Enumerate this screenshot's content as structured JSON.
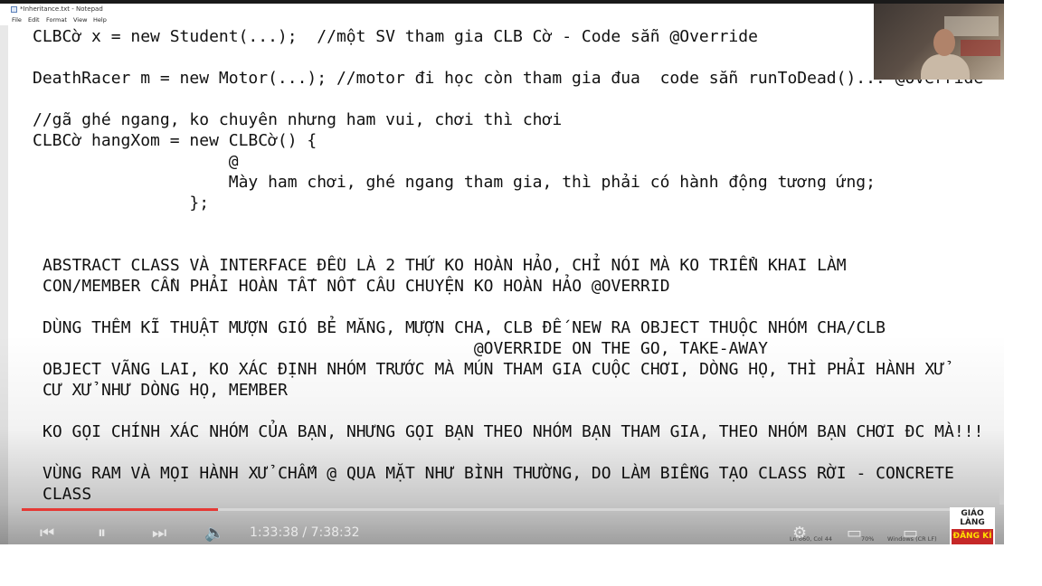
{
  "window": {
    "title": "*Inheritance.txt - Notepad",
    "menu": [
      "File",
      "Edit",
      "Format",
      "View",
      "Help"
    ]
  },
  "editor": {
    "lines": [
      "CLBCờ x = new Student(...);  //một SV tham gia CLB Cờ - Code sẵn @Override",
      "DeathRacer m = new Motor(...); //motor đi học còn tham gia đua  code sẵn runToDead()... @Override",
      "//gã ghé ngang, ko chuyên nhưng ham vui, chơi thì chơi",
      "CLBCờ hangXom = new CLBCờ() {",
      "                    @",
      "                    Mày ham chơi, ghé ngang tham gia, thì phải có hành động tương ứng;",
      "                };",
      "ABSTRACT CLASS VÀ INTERFACE ĐỀU LÀ 2 THỨ KO HOÀN HẢO, CHỈ NÓI MÀ KO TRIỂN KHAI LÀM",
      "CON/MEMBER CẦN PHẢI HOÀN TẤT NỐT CÂU CHUYỆN KO HOÀN HẢO @OVERRID",
      "DÙNG THÊM KĨ THUẬT MƯỢN GIÓ BẺ MĂNG, MƯỢN CHA, CLB ĐẾ NEW RA OBJECT THUỘC NHÓM CHA/CLB",
      "                                            @OVERRIDE ON THE GO, TAKE-AWAY",
      "OBJECT VÃNG LAI, KO XÁC ĐỊNH NHÓM TRƯỚC MÀ MÚN THAM GIA CUỘC CHƠI, DÒNG HỌ, THÌ PHẢI HÀNH XỬ",
      "CƯ XỬ NHƯ DÒNG HỌ, MEMBER",
      "KO GỌI CHÍNH XÁC NHÓM CỦA BẠN, NHƯNG GỌI BẠN THEO NHÓM BẠN THAM GIA, THEO NHÓM BẠN CHƠI ĐC MÀ!!!",
      "VÙNG RAM VÀ MỌI HÀNH XỬ CHẤM @ QUA MẶT NHƯ BÌNH THƯỜNG, DO LÀM BIẾNG TẠO CLASS RỜI - CONCRETE",
      "CLASS"
    ]
  },
  "statusbar": {
    "position": "Ln 660, Col 44",
    "zoom": "70%",
    "encoding": "Windows (CR LF)"
  },
  "player": {
    "time": "1:33:38 / 7:38:32",
    "progress": 0.2041,
    "icons": [
      "skip-back-icon",
      "pause-icon",
      "skip-next-icon",
      "volume-icon",
      "settings-icon",
      "miniplayer-icon",
      "fullscreen-icon"
    ]
  },
  "channel": {
    "name": "GIÁO LÀNG",
    "subscribe": "ĐĂNG KÍ"
  }
}
